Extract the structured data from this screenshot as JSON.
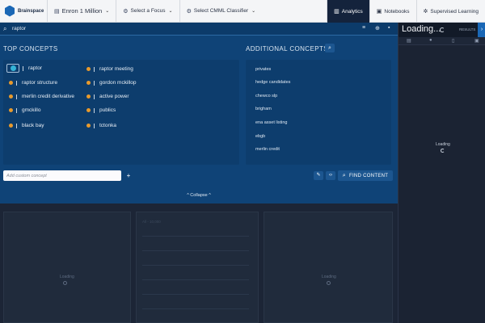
{
  "nav": {
    "logo_text": "Brainspace",
    "dataset": "Enron 1 Million",
    "focus": "Select a Focus",
    "classifier": "Select CMML Classifier",
    "tabs": [
      {
        "label": "Analytics",
        "active": true
      },
      {
        "label": "Notebooks",
        "active": false
      },
      {
        "label": "Supervised Learning",
        "active": false
      }
    ]
  },
  "search": {
    "value": "raptor"
  },
  "top_concepts": {
    "title": "TOP CONCEPTS",
    "items": [
      "raptor",
      "raptor structure",
      "merlin credit derivative",
      "gmckillo",
      "black bay",
      "raptor meeting",
      "gordon mckillop",
      "active power",
      "publics",
      "tctonka"
    ]
  },
  "additional_concepts": {
    "title": "ADDITIONAL CONCEPTS",
    "items": [
      "privates",
      "hedge candidates",
      "chewco slp",
      "brigham",
      "ena asset listing",
      "ebgb",
      "merlin credit"
    ]
  },
  "custom_concept": {
    "placeholder": "Add custom concept"
  },
  "find_button": "FIND CONTENT",
  "collapse": "^ Collapse ^",
  "background": {
    "loading_left": "Loading",
    "loading_right": "Loading",
    "select_text": "All - 10,000"
  },
  "side_panel": {
    "title": "Loading...",
    "results_label": "RESULTS",
    "loading": "Loading"
  },
  "colors": {
    "panel": "#0f4377",
    "accent_orange": "#e89a2c",
    "selected_teal": "#35b4d6",
    "active_tab": "#14233c"
  }
}
